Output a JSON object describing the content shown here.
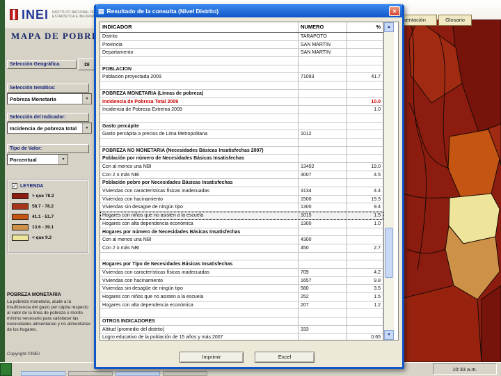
{
  "header": {
    "logo_text": "INEI",
    "logo_tagline_1": "INSTITUTO NACIONAL DE",
    "logo_tagline_2": "ESTADÍSTICA E INFORMÁTICA",
    "page_title": "MAPA DE POBREZA"
  },
  "top_buttons": {
    "presentation": "Presentación",
    "glossary": "Glosario"
  },
  "sidebar": {
    "geo_header": "Selección Geográfica.",
    "geo_button": "Di",
    "theme_label": "Selección temática:",
    "theme_value": "Pobreza Monetaria",
    "indicator_label": "Selección del Indicador:",
    "indicator_value": "Incidencia de pobreza total",
    "value_type_label": "Tipo de Valor:",
    "value_type_value": "Porcentual",
    "legend": {
      "title": "LEYENDA",
      "items": [
        {
          "range": "> que 78.2",
          "color": "#8C1C0F"
        },
        {
          "range": "58.7 - 78.2",
          "color": "#A93618"
        },
        {
          "range": "41.1 - 51.7",
          "color": "#C45513"
        },
        {
          "range": "13.6 - 39.1",
          "color": "#CE9148"
        },
        {
          "range": "< que 9.3",
          "color": "#EEE49A"
        }
      ]
    },
    "info_heading": "POBREZA MONETARIA",
    "info_body": "La pobreza monetaria, alude a la insuficiencia del gasto per cápita respecto al valor de la línea de pobreza o monto mínimo necesario para satisfacer las necesidades alimentarias y no alimentarias de los hogares.",
    "copyright": "Copyright ©INEI"
  },
  "dialog": {
    "title": "Resultado de la consulta (Nivel Distrito)",
    "accent_red": "#CC0000",
    "table": {
      "columns": [
        "INDICADOR",
        "NUMERO",
        "%"
      ],
      "rows": [
        {
          "label": "Distrito",
          "numero": "TARAPOTO",
          "pct": "",
          "type": "plain"
        },
        {
          "label": "Provincia",
          "numero": "SAN MARTIN",
          "pct": "",
          "type": "plain"
        },
        {
          "label": "Departamento",
          "numero": "SAN MARTIN",
          "pct": "",
          "type": "plain"
        },
        {
          "label": "",
          "numero": "",
          "pct": "",
          "type": "spacer"
        },
        {
          "label": "POBLACION",
          "numero": "",
          "pct": "",
          "type": "section"
        },
        {
          "label": "Población proyectada 2009",
          "numero": "71093",
          "pct": "41.7",
          "type": "plain"
        },
        {
          "label": "",
          "numero": "",
          "pct": "",
          "type": "spacer"
        },
        {
          "label": "POBREZA MONETARIA (Líneas de pobreza)",
          "numero": "",
          "pct": "",
          "type": "section"
        },
        {
          "label": "Incidencia de Pobreza Total 2009",
          "numero": "",
          "pct": "10.0",
          "type": "red"
        },
        {
          "label": "Incidencia de Pobreza Extrema 2009",
          "numero": "",
          "pct": "1.0",
          "type": "plain"
        },
        {
          "label": "",
          "numero": "",
          "pct": "",
          "type": "spacer"
        },
        {
          "label": "Gasto percápite",
          "numero": "",
          "pct": "",
          "type": "section"
        },
        {
          "label": "Gasto percápita a precios de Lima Metropolitana",
          "numero": "1012",
          "pct": "",
          "type": "plain"
        },
        {
          "label": "",
          "numero": "",
          "pct": "",
          "type": "spacer"
        },
        {
          "label": "POBREZA NO MONETARIA (Necesidades Básicas Insatisfechas 2007)",
          "numero": "",
          "pct": "",
          "type": "section"
        },
        {
          "label": "Población por número de Necesidades Básicas Insatisfechas",
          "numero": "",
          "pct": "",
          "type": "sub"
        },
        {
          "label": "Con al menos una NBI",
          "numero": "13402",
          "pct": "19.0",
          "type": "plain"
        },
        {
          "label": "Con 2 o más NBI",
          "numero": "3007",
          "pct": "4.5",
          "type": "plain"
        },
        {
          "label": "Población pobre por Necesidades Básicas Insatisfechas",
          "numero": "",
          "pct": "",
          "type": "sub"
        },
        {
          "label": "Viviendas con características físicas inadecuadas",
          "numero": "3134",
          "pct": "4.4",
          "type": "plain"
        },
        {
          "label": "Viviendas con hacinamiento",
          "numero": "1500",
          "pct": "19.5",
          "type": "plain"
        },
        {
          "label": "Viviendas sin desagüe de ningún tipo",
          "numero": "1300",
          "pct": "9.4",
          "type": "plain"
        },
        {
          "label": "Hogares con niños que no asisten a la escuela",
          "numero": "1015",
          "pct": "1.5",
          "type": "selected"
        },
        {
          "label": "Hogares con alta dependencia económica",
          "numero": "1300",
          "pct": "1.0",
          "type": "plain"
        },
        {
          "label": "Hogares por número de Necesidades Básicas Insatisfechas",
          "numero": "",
          "pct": "",
          "type": "sub"
        },
        {
          "label": "Con al menos una NBI",
          "numero": "4300",
          "pct": "",
          "type": "plain"
        },
        {
          "label": "Con 2 o más NBI",
          "numero": "450",
          "pct": "2.7",
          "type": "plain"
        },
        {
          "label": "",
          "numero": "",
          "pct": "",
          "type": "spacer"
        },
        {
          "label": "Hogares por Tipo de Necesidades Básicas Insatisfechas",
          "numero": "",
          "pct": "",
          "type": "sub"
        },
        {
          "label": "Viviendas con características físicas inadecuadas",
          "numero": "709",
          "pct": "4.2",
          "type": "plain"
        },
        {
          "label": "Viviendas con hacinamiento",
          "numero": "1657",
          "pct": "9.8",
          "type": "plain"
        },
        {
          "label": "Viviendas sin desagüe de ningún tipo",
          "numero": "580",
          "pct": "3.5",
          "type": "plain"
        },
        {
          "label": "Hogares con niños que no asisten a la escuela",
          "numero": "252",
          "pct": "1.5",
          "type": "plain"
        },
        {
          "label": "Hogares con alta dependencia económica",
          "numero": "207",
          "pct": "1.2",
          "type": "plain"
        },
        {
          "label": "",
          "numero": "",
          "pct": "",
          "type": "spacer"
        },
        {
          "label": "OTROS INDICADORES",
          "numero": "",
          "pct": "",
          "type": "section"
        },
        {
          "label": "Altitud (promedio del distrito)",
          "numero": "333",
          "pct": "",
          "type": "plain"
        },
        {
          "label": "Logro educativo de la población de 15 años y más 2007",
          "numero": "",
          "pct": "0.65",
          "type": "plain"
        }
      ]
    },
    "buttons": {
      "print": "Imprimir",
      "excel": "Excel"
    }
  },
  "map": {
    "palette": {
      "darkest": "#76140B",
      "dark": "#8C1C0F",
      "mid": "#A02A12",
      "bottom": "#97230F",
      "orange": "#C45513",
      "yellow": "#EEE49A",
      "tan": "#CE9148"
    }
  },
  "taskbar": {
    "time": "10:33 a.m."
  }
}
